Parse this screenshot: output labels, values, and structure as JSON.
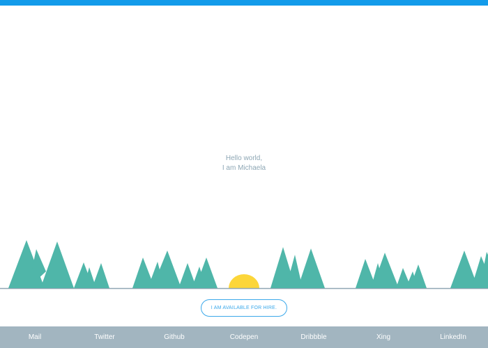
{
  "intro": {
    "greeting": "Hello world,",
    "name_line": "I am Michaela"
  },
  "hire_button": {
    "label": "I AM AVAILABLE FOR HIRE."
  },
  "footer": {
    "links": [
      "Mail",
      "Twitter",
      "Github",
      "Codepen",
      "Dribbble",
      "Xing",
      "LinkedIn"
    ]
  },
  "colors": {
    "accent": "#139bea",
    "mountain": "#4fb6a9",
    "sun": "#fcd63a",
    "horizon": "#8fa6b3",
    "footer_bg": "#a2b5c0"
  }
}
